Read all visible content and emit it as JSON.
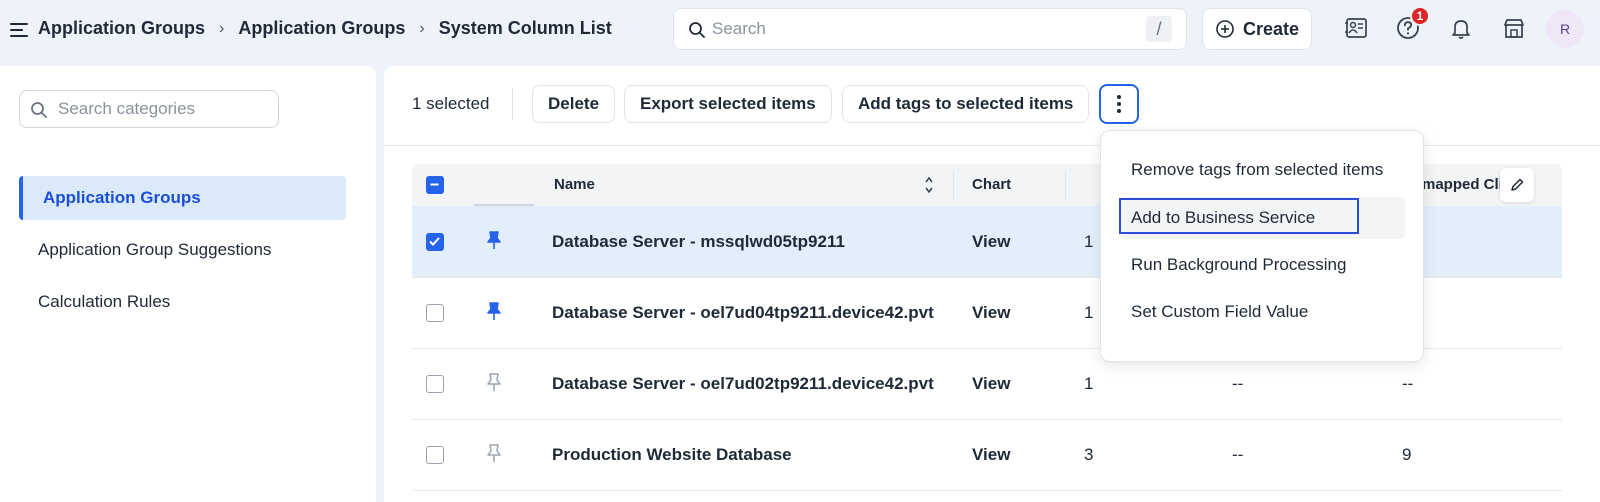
{
  "breadcrumb": {
    "items": [
      "Application Groups",
      "Application Groups",
      "System Column List"
    ],
    "separator": "›"
  },
  "search": {
    "placeholder": "Search",
    "shortcut": "/"
  },
  "header": {
    "create_label": "Create",
    "notification_count": "1",
    "avatar_initial": "R"
  },
  "sidebar": {
    "search_placeholder": "Search categories",
    "items": [
      {
        "label": "Application Groups",
        "active": true
      },
      {
        "label": "Application Group Suggestions",
        "active": false
      },
      {
        "label": "Calculation Rules",
        "active": false
      }
    ]
  },
  "toolbar": {
    "selected_count": "1 selected",
    "delete_label": "Delete",
    "export_label": "Export selected items",
    "add_tags_label": "Add tags to selected items"
  },
  "table": {
    "columns": {
      "name": "Name",
      "chart": "Chart",
      "unmapped": "Unmapped Cli"
    },
    "rows": [
      {
        "name": "Database Server - mssqlwd05tp9211",
        "chart": "View",
        "c3": "1",
        "c4": "",
        "c5": "--",
        "checked": true,
        "pinned": true
      },
      {
        "name": "Database Server - oel7ud04tp9211.device42.pvt",
        "chart": "View",
        "c3": "1",
        "c4": "",
        "c5": "--",
        "checked": false,
        "pinned": true
      },
      {
        "name": "Database Server - oel7ud02tp9211.device42.pvt",
        "chart": "View",
        "c3": "1",
        "c4": "--",
        "c5": "--",
        "checked": false,
        "pinned": false
      },
      {
        "name": "Production Website Database",
        "chart": "View",
        "c3": "3",
        "c4": "--",
        "c5": "9",
        "checked": false,
        "pinned": false
      }
    ]
  },
  "dropdown": {
    "items": [
      "Remove tags from selected items",
      "Add to Business Service",
      "Run Background Processing",
      "Set Custom Field Value"
    ]
  },
  "colors": {
    "accent": "#2563eb",
    "selected_row": "#e3eefb",
    "active_nav": "#dbeafa",
    "badge": "#dc2626"
  }
}
